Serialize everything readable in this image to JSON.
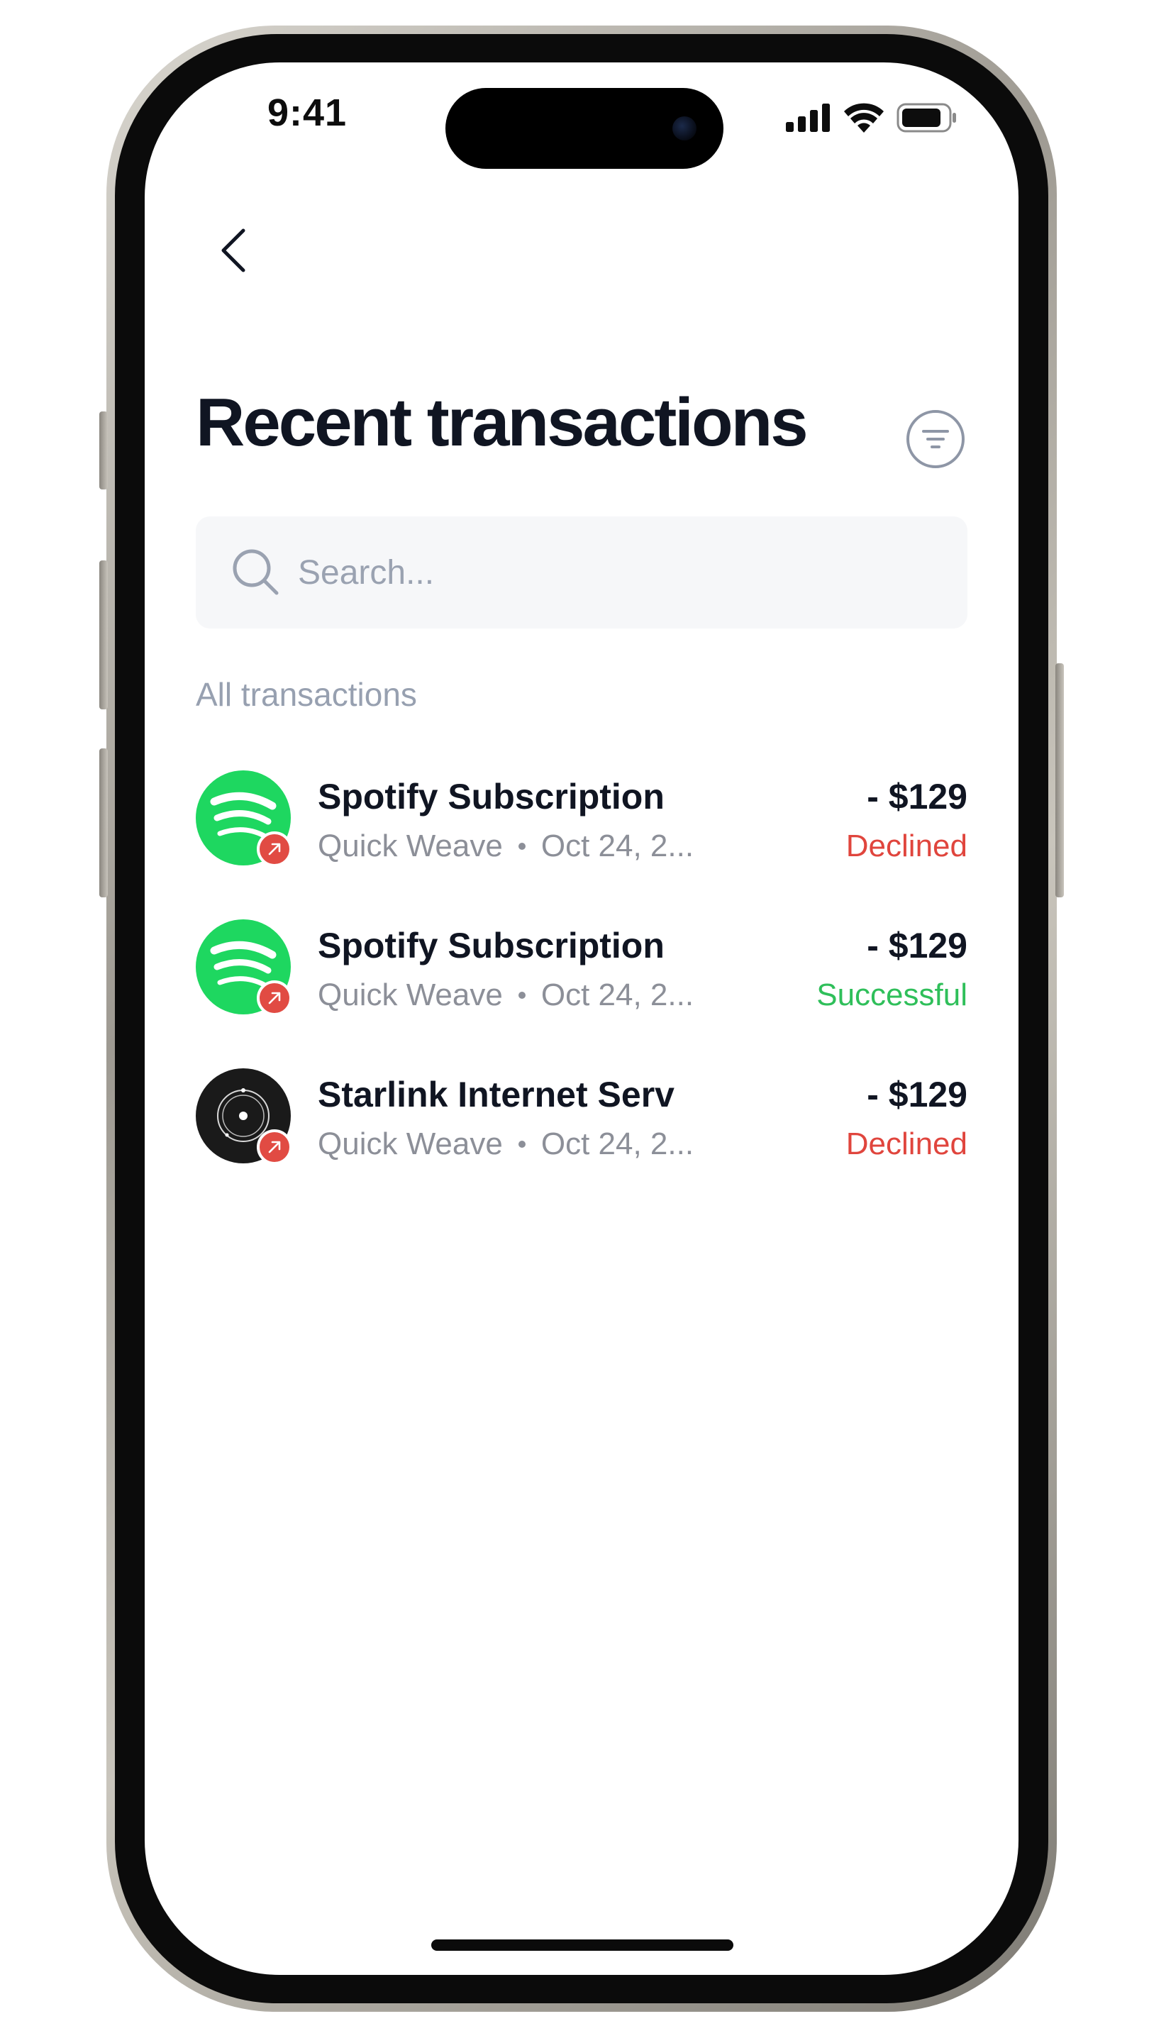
{
  "status_bar": {
    "time": "9:41"
  },
  "header": {
    "title": "Recent transactions",
    "back_icon": "chevron-left-icon",
    "filter_icon": "filter-lines-icon"
  },
  "search": {
    "placeholder": "Search...",
    "value": "",
    "icon": "search-icon"
  },
  "section": {
    "label": "All transactions"
  },
  "colors": {
    "declined": "#e0453d",
    "successful": "#2fbf5a",
    "spotify_green": "#1ed760",
    "badge_red": "#e14b43",
    "title": "#101522"
  },
  "transactions": [
    {
      "name": "Spotify Subscription",
      "merchant": "Quick Weave",
      "date": "Oct 24, 2...",
      "amount": "- $129",
      "status": "Declined",
      "status_kind": "declined",
      "logo": "spotify-logo",
      "direction_icon": "arrow-up-right-icon"
    },
    {
      "name": "Spotify Subscription",
      "merchant": "Quick Weave",
      "date": "Oct 24, 2...",
      "amount": "- $129",
      "status": "Successful",
      "status_kind": "successful",
      "logo": "spotify-logo",
      "direction_icon": "arrow-up-right-icon"
    },
    {
      "name": "Starlink Internet Serv",
      "merchant": "Quick Weave",
      "date": "Oct 24, 2...",
      "amount": "- $129",
      "status": "Declined",
      "status_kind": "declined",
      "logo": "starlink-logo",
      "direction_icon": "arrow-up-right-icon"
    }
  ]
}
